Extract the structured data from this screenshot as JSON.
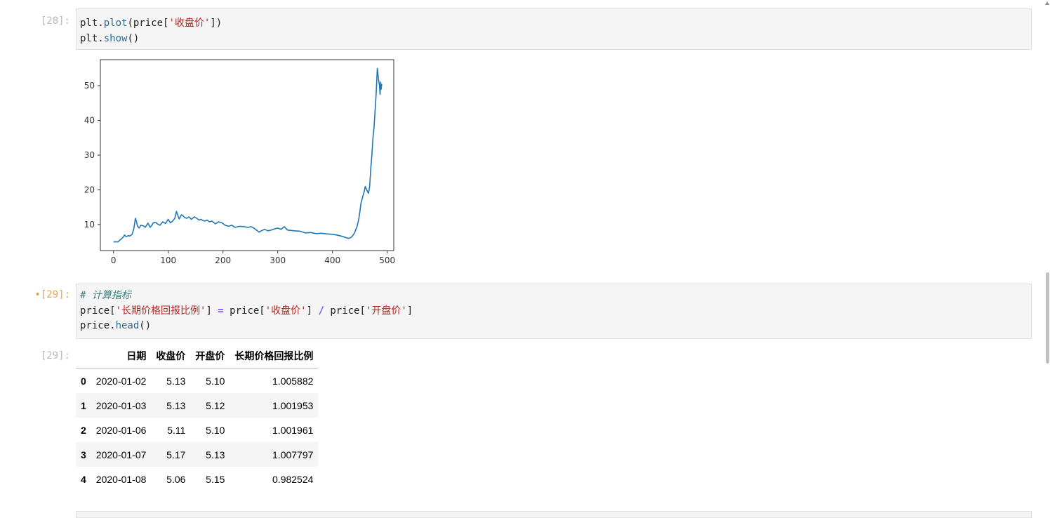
{
  "cells": [
    {
      "prompt": "[28]:",
      "code": [
        [
          {
            "t": "plt.",
            "c": ""
          },
          {
            "t": "plot",
            "c": "fn"
          },
          {
            "t": "(price[",
            "c": ""
          },
          {
            "t": "'收盘价'",
            "c": "str"
          },
          {
            "t": "])",
            "c": ""
          }
        ],
        [
          {
            "t": "plt.",
            "c": ""
          },
          {
            "t": "show",
            "c": "fn"
          },
          {
            "t": "()",
            "c": ""
          }
        ]
      ]
    },
    {
      "prompt": "•[29]:",
      "code": [
        [
          {
            "t": "# 计算指标",
            "c": "cmt"
          }
        ],
        [
          {
            "t": "price[",
            "c": ""
          },
          {
            "t": "'长期价格回报比例'",
            "c": "str"
          },
          {
            "t": "] ",
            "c": ""
          },
          {
            "t": "=",
            "c": "kw"
          },
          {
            "t": " price[",
            "c": ""
          },
          {
            "t": "'收盘价'",
            "c": "str"
          },
          {
            "t": "] ",
            "c": ""
          },
          {
            "t": "/",
            "c": "kw"
          },
          {
            "t": " price[",
            "c": ""
          },
          {
            "t": "'开盘价'",
            "c": "str"
          },
          {
            "t": "]",
            "c": ""
          }
        ],
        [
          {
            "t": "price.",
            "c": ""
          },
          {
            "t": "head",
            "c": "fn"
          },
          {
            "t": "()",
            "c": ""
          }
        ]
      ]
    }
  ],
  "output_prompt": "[29]:",
  "chart_data": {
    "type": "line",
    "title": "",
    "xlabel": "",
    "ylabel": "",
    "xlim": [
      -24,
      512
    ],
    "ylim": [
      2.5,
      57.5
    ],
    "xticks": [
      0,
      100,
      200,
      300,
      400,
      500
    ],
    "yticks": [
      10,
      20,
      30,
      40,
      50
    ],
    "grid": false,
    "line_color": "#1f77b4",
    "series": [
      {
        "x": [
          0,
          8,
          13,
          18,
          20,
          23,
          27,
          30,
          34,
          37,
          40,
          42,
          44,
          47,
          50,
          55,
          58,
          63,
          67,
          70,
          73,
          77,
          80,
          85,
          90,
          95,
          100,
          104,
          108,
          112,
          115,
          118,
          120,
          124,
          127,
          130,
          134,
          138,
          142,
          148,
          152,
          156,
          160,
          163,
          167,
          171,
          175,
          180,
          186,
          192,
          198,
          204,
          210,
          216,
          222,
          230,
          238,
          246,
          252,
          258,
          262,
          266,
          270,
          276,
          282,
          288,
          294,
          300,
          306,
          312,
          318,
          324,
          330,
          340,
          350,
          360,
          370,
          380,
          390,
          400,
          410,
          420,
          425,
          430,
          435,
          440,
          445,
          448,
          450,
          452,
          455,
          458,
          460,
          462,
          464,
          466,
          468,
          470,
          472,
          474,
          476,
          478,
          480,
          482,
          484,
          486,
          487,
          488,
          489,
          490
        ],
        "y": [
          5,
          5,
          5.7,
          6.4,
          7,
          6.5,
          6.8,
          6.7,
          7.2,
          8.7,
          11.8,
          10.8,
          9.5,
          9,
          9.8,
          9.6,
          9.2,
          10.4,
          9.2,
          9.8,
          10.5,
          10.6,
          10.2,
          9.8,
          10.8,
          10.3,
          11.5,
          10.5,
          11,
          11.8,
          13.8,
          12.4,
          11.6,
          12.8,
          12.5,
          12,
          11.8,
          12.2,
          11.5,
          12.2,
          11.8,
          11.3,
          11.5,
          11.2,
          11,
          11.3,
          10.8,
          11,
          10.2,
          10.8,
          10.5,
          9.8,
          9.5,
          9.8,
          9.2,
          9.5,
          9.4,
          9.2,
          9.4,
          8.8,
          8.3,
          7.8,
          8.2,
          8.6,
          8.2,
          8.4,
          8.7,
          9,
          8.6,
          9.4,
          8.4,
          8.3,
          8.2,
          8.1,
          7.6,
          7.7,
          7.4,
          7.5,
          7.3,
          7.2,
          6.9,
          6.5,
          6.2,
          6.0,
          6.4,
          7.5,
          9.5,
          11.5,
          13.5,
          16,
          17.8,
          19.5,
          21,
          20.2,
          19.5,
          19,
          21,
          26,
          30,
          35,
          38,
          43,
          48,
          55,
          52,
          50,
          47.5,
          51,
          49,
          50.5
        ]
      }
    ]
  },
  "table": {
    "columns": [
      "",
      "日期",
      "收盘价",
      "开盘价",
      "长期价格回报比例"
    ],
    "rows": [
      [
        "0",
        "2020-01-02",
        "5.13",
        "5.10",
        "1.005882"
      ],
      [
        "1",
        "2020-01-03",
        "5.13",
        "5.12",
        "1.001953"
      ],
      [
        "2",
        "2020-01-06",
        "5.11",
        "5.10",
        "1.001961"
      ],
      [
        "3",
        "2020-01-07",
        "5.17",
        "5.13",
        "1.007797"
      ],
      [
        "4",
        "2020-01-08",
        "5.06",
        "5.15",
        "0.982524"
      ]
    ]
  }
}
